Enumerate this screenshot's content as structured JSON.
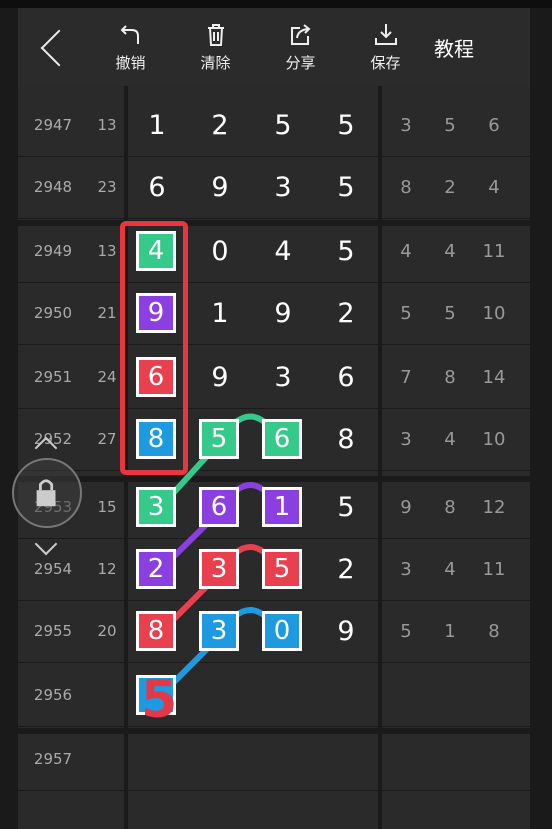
{
  "toolbar": {
    "undo_label": "撤销",
    "clear_label": "清除",
    "share_label": "分享",
    "save_label": "保存",
    "tutorial_label": "教程"
  },
  "rows": [
    {
      "id": "2947",
      "sum": "13",
      "d": [
        "1",
        "2",
        "5",
        "5"
      ],
      "s": [
        "3",
        "5",
        "6"
      ]
    },
    {
      "id": "2948",
      "sum": "23",
      "d": [
        "6",
        "9",
        "3",
        "5"
      ],
      "s": [
        "8",
        "2",
        "4"
      ]
    },
    {
      "id": "2949",
      "sum": "13",
      "d": [
        "4",
        "0",
        "4",
        "5"
      ],
      "s": [
        "4",
        "4",
        "11"
      ]
    },
    {
      "id": "2950",
      "sum": "21",
      "d": [
        "9",
        "1",
        "9",
        "2"
      ],
      "s": [
        "5",
        "5",
        "10"
      ]
    },
    {
      "id": "2951",
      "sum": "24",
      "d": [
        "6",
        "9",
        "3",
        "6"
      ],
      "s": [
        "7",
        "8",
        "14"
      ]
    },
    {
      "id": "2952",
      "sum": "27",
      "d": [
        "8",
        "5",
        "6",
        "8"
      ],
      "s": [
        "3",
        "4",
        "10"
      ]
    },
    {
      "id": "2953",
      "sum": "15",
      "d": [
        "3",
        "6",
        "1",
        "5"
      ],
      "s": [
        "9",
        "8",
        "12"
      ]
    },
    {
      "id": "2954",
      "sum": "12",
      "d": [
        "2",
        "3",
        "5",
        "2"
      ],
      "s": [
        "3",
        "4",
        "11"
      ]
    },
    {
      "id": "2955",
      "sum": "20",
      "d": [
        "8",
        "3",
        "0",
        "9"
      ],
      "s": [
        "5",
        "1",
        "8"
      ]
    },
    {
      "id": "2956",
      "sum": "",
      "d": [
        "",
        "",
        "",
        ""
      ],
      "s": [
        "",
        "",
        ""
      ]
    },
    {
      "id": "2957",
      "sum": "",
      "d": [
        "",
        "",
        "",
        ""
      ],
      "s": [
        "",
        "",
        ""
      ]
    }
  ],
  "annotation": {
    "big_digit": "5"
  },
  "colors": {
    "green": "#35c98a",
    "purple": "#8b3fe0",
    "red": "#e8404e",
    "blue": "#1e9ae0",
    "frame": "#e8353f"
  }
}
